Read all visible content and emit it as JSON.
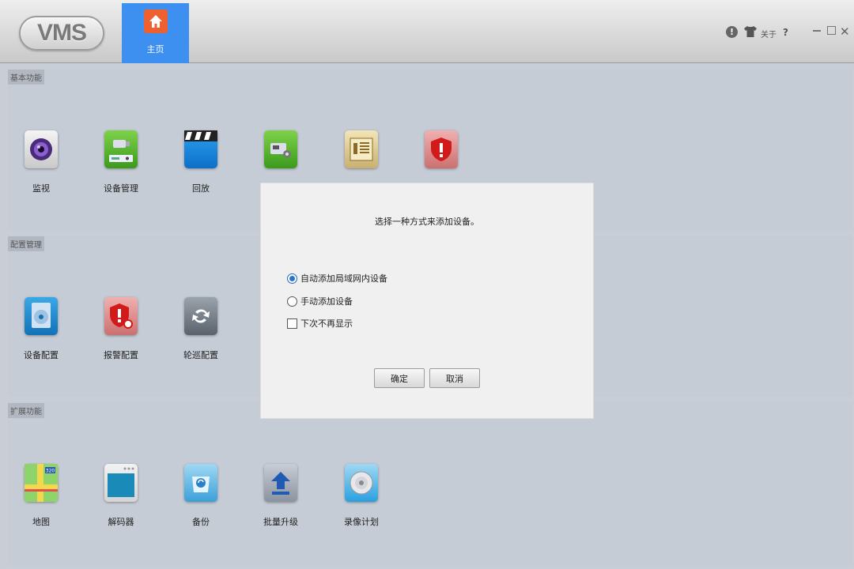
{
  "app": {
    "logo": "VMS"
  },
  "header": {
    "home_tab": "主页",
    "about": "关于",
    "help": "?"
  },
  "sections": [
    {
      "title": "基本功能",
      "items": [
        {
          "label": "监视",
          "icon": "monitor-camera-icon"
        },
        {
          "label": "设备管理",
          "icon": "device-manager-icon"
        },
        {
          "label": "回放",
          "icon": "playback-clapper-icon"
        },
        {
          "label": "",
          "icon": "device-settings-icon"
        },
        {
          "label": "",
          "icon": "log-document-icon"
        },
        {
          "label": "",
          "icon": "alarm-shield-icon"
        }
      ]
    },
    {
      "title": "配置管理",
      "items": [
        {
          "label": "设备配置",
          "icon": "device-config-icon"
        },
        {
          "label": "报警配置",
          "icon": "alarm-config-icon"
        },
        {
          "label": "轮巡配置",
          "icon": "tour-config-icon"
        }
      ]
    },
    {
      "title": "扩展功能",
      "items": [
        {
          "label": "地图",
          "icon": "map-icon"
        },
        {
          "label": "解码器",
          "icon": "decoder-icon"
        },
        {
          "label": "备份",
          "icon": "backup-icon"
        },
        {
          "label": "批量升级",
          "icon": "batch-upgrade-icon"
        },
        {
          "label": "录像计划",
          "icon": "record-plan-icon"
        }
      ]
    }
  ],
  "dialog": {
    "message": "选择一种方式来添加设备。",
    "option_auto": "自动添加局域网内设备",
    "option_manual": "手动添加设备",
    "dont_show": "下次不再显示",
    "selected": "auto",
    "ok": "确定",
    "cancel": "取消"
  },
  "colors": {
    "accent": "#3d8ff0",
    "home_icon": "#ef6030"
  }
}
